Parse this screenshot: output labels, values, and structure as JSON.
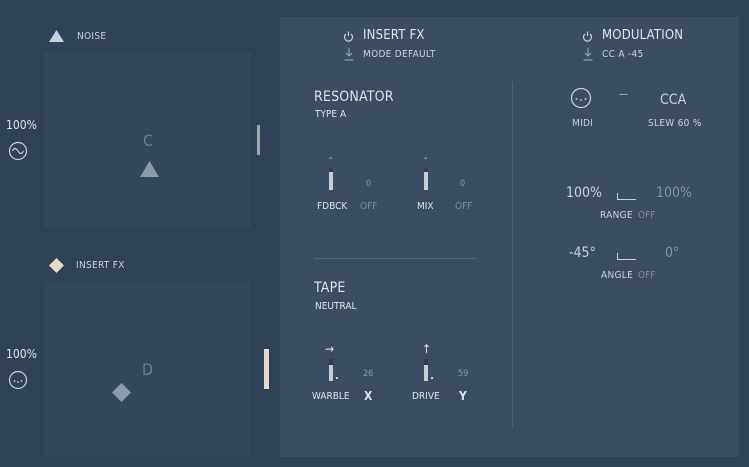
{
  "left": {
    "pad_top": {
      "title": "NOISE",
      "letter": "C",
      "level": "100%"
    },
    "pad_bottom": {
      "title": "INSERT FX",
      "letter": "D",
      "level": "100%"
    }
  },
  "header": {
    "insert_fx": {
      "title": "INSERT FX",
      "mode": "MODE DEFAULT"
    },
    "modulation": {
      "title": "MODULATION",
      "source": "CC A -45"
    }
  },
  "resonator": {
    "title": "RESONATOR",
    "type": "TYPE A",
    "fdbck": {
      "label": "FDBCK",
      "value": "0",
      "state": "OFF",
      "mark": "-"
    },
    "mix": {
      "label": "MIX",
      "value": "0",
      "state": "OFF",
      "mark": "-"
    }
  },
  "tape": {
    "title": "TAPE",
    "type": "NEUTRAL",
    "warble": {
      "label": "WARBLE",
      "value": "26",
      "axis": "X",
      "arrow": "→"
    },
    "drive": {
      "label": "DRIVE",
      "value": "59",
      "axis": "Y",
      "arrow": "↑"
    }
  },
  "modulation_panel": {
    "midi_label": "MIDI",
    "dash": "—",
    "cca_label": "CCA",
    "slew": "SLEW 60 %",
    "range": {
      "left": "100%",
      "right": "100%",
      "label": "RANGE",
      "state": "OFF"
    },
    "angle": {
      "left": "-45°",
      "right": "0°",
      "label": "ANGLE",
      "state": "OFF"
    }
  },
  "colors": {
    "bg": "#2f4258",
    "panel": "#3b4d63",
    "pad": "#34475e",
    "accent_light": "#e6d9c8"
  }
}
